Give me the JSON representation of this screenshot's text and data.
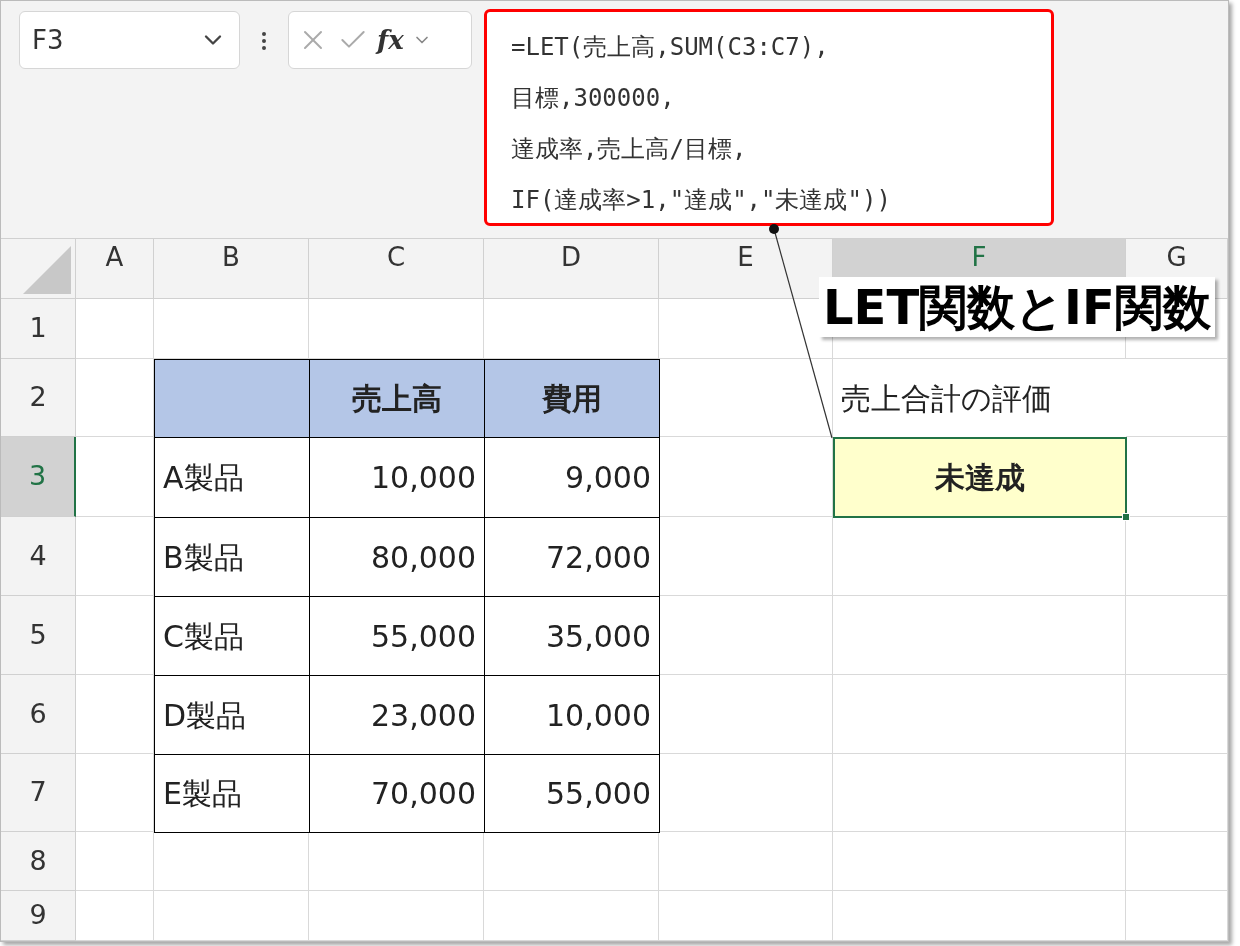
{
  "name_box": {
    "value": "F3"
  },
  "formula_bar": {
    "function_label": "fx",
    "lines": [
      "=LET(売上高,SUM(C3:C7),",
      "目標,300000,",
      "達成率,売上高/目標,",
      "IF(達成率>1,\"達成\",\"未達成\"))"
    ]
  },
  "columns": [
    {
      "label": "A",
      "selected": false
    },
    {
      "label": "B",
      "selected": false
    },
    {
      "label": "C",
      "selected": false
    },
    {
      "label": "D",
      "selected": false
    },
    {
      "label": "E",
      "selected": false
    },
    {
      "label": "F",
      "selected": true
    },
    {
      "label": "G",
      "selected": false
    }
  ],
  "rows": [
    {
      "label": "1",
      "selected": false
    },
    {
      "label": "2",
      "selected": false
    },
    {
      "label": "3",
      "selected": true
    },
    {
      "label": "4",
      "selected": false
    },
    {
      "label": "5",
      "selected": false
    },
    {
      "label": "6",
      "selected": false
    },
    {
      "label": "7",
      "selected": false
    },
    {
      "label": "8",
      "selected": false
    },
    {
      "label": "9",
      "selected": false
    }
  ],
  "table": {
    "columns": [
      "売上高",
      "費用"
    ],
    "rows": [
      {
        "name": "A製品",
        "values": [
          "10,000",
          "9,000"
        ]
      },
      {
        "name": "B製品",
        "values": [
          "80,000",
          "72,000"
        ]
      },
      {
        "name": "C製品",
        "values": [
          "55,000",
          "35,000"
        ]
      },
      {
        "name": "D製品",
        "values": [
          "23,000",
          "10,000"
        ]
      },
      {
        "name": "E製品",
        "values": [
          "70,000",
          "55,000"
        ]
      }
    ]
  },
  "evaluation": {
    "label": "売上合計の評価",
    "result": "未達成",
    "selected": true
  },
  "callout": {
    "text": "LET関数とIF関数"
  }
}
